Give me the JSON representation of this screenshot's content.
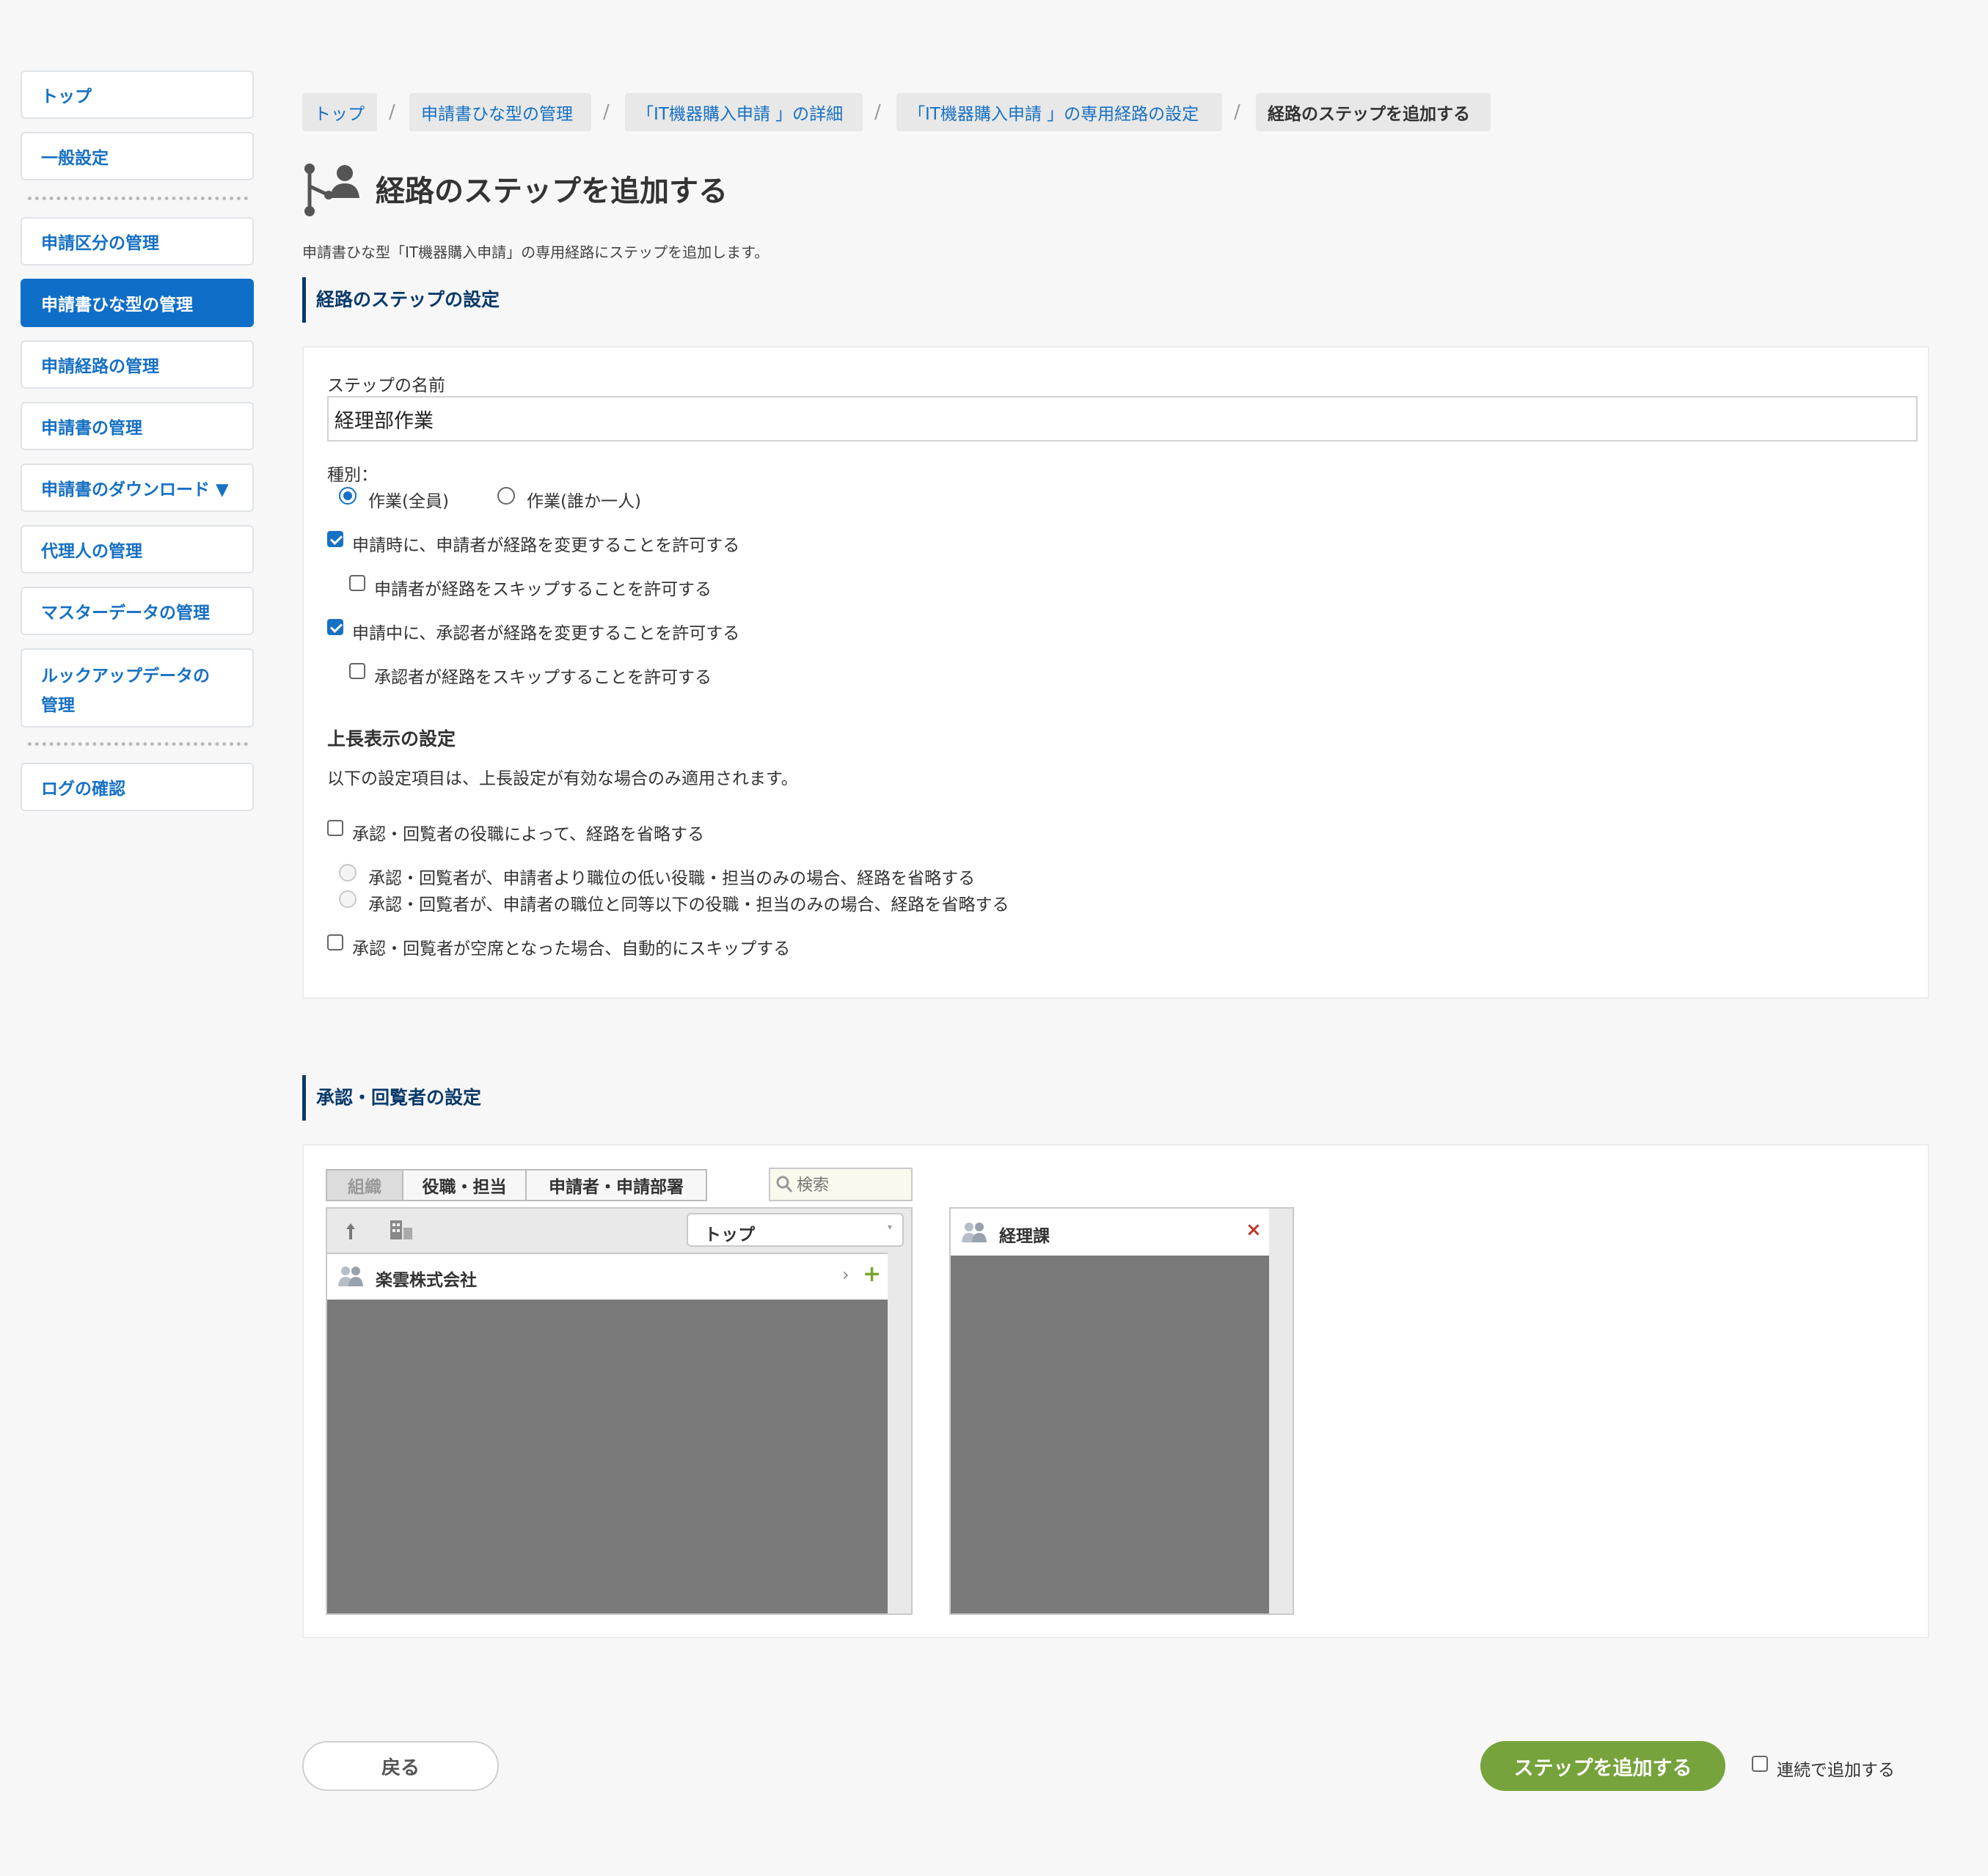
{
  "sidebar": {
    "items": [
      {
        "label": "トップ"
      },
      {
        "label": "一般設定"
      },
      {
        "label": "申請区分の管理"
      },
      {
        "label": "申請書ひな型の管理"
      },
      {
        "label": "申請経路の管理"
      },
      {
        "label": "申請書の管理"
      },
      {
        "label": "申請書のダウンロード ▼"
      },
      {
        "label": "代理人の管理"
      },
      {
        "label": "マスターデータの管理"
      },
      {
        "label": "ルックアップデータの管理"
      },
      {
        "label": "ログの確認"
      }
    ]
  },
  "breadcrumb": [
    {
      "label": "トップ"
    },
    {
      "label": "申請書ひな型の管理"
    },
    {
      "label": "「IT機器購入申請 」の詳細"
    },
    {
      "label": "「IT機器購入申請 」の専用経路の設定"
    },
    {
      "label": "経路のステップを追加する"
    }
  ],
  "breadcrumb_separator": "/",
  "page": {
    "title": "経路のステップを追加する",
    "description": "申請書ひな型「IT機器購入申請」の専用経路にステップを追加します。"
  },
  "step_settings": {
    "heading": "経路のステップの設定",
    "name_label": "ステップの名前",
    "name_value": "経理部作業",
    "type_label": "種別：",
    "type_options": [
      {
        "label": "作業(全員)"
      },
      {
        "label": "作業(誰か一人)"
      }
    ],
    "permissions": [
      {
        "label": "申請時に、申請者が経路を変更することを許可する"
      },
      {
        "label": "申請者が経路をスキップすることを許可する"
      },
      {
        "label": "申請中に、承認者が経路を変更することを許可する"
      },
      {
        "label": "承認者が経路をスキップすることを許可する"
      }
    ],
    "superior_heading": "上長表示の設定",
    "superior_note": "以下の設定項目は、上長設定が有効な場合のみ適用されます。",
    "omit_by_position_label": "承認・回覧者の役職によって、経路を省略する",
    "omit_options": [
      {
        "label": "承認・回覧者が、申請者より職位の低い役職・担当のみの場合、経路を省略する"
      },
      {
        "label": "承認・回覧者が、申請者の職位と同等以下の役職・担当のみの場合、経路を省略する"
      }
    ],
    "skip_vacant_label": "承認・回覧者が空席となった場合、自動的にスキップする"
  },
  "approver_settings": {
    "heading": "承認・回覧者の設定",
    "tabs": [
      {
        "label": "組織"
      },
      {
        "label": "役職・担当"
      },
      {
        "label": "申請者・申請部署"
      }
    ],
    "search_placeholder": "検索",
    "org_select_value": "トップ",
    "org_list": [
      {
        "label": "楽雲株式会社"
      }
    ],
    "selected_list": [
      {
        "label": "経理課"
      }
    ]
  },
  "footer": {
    "back_label": "戻る",
    "submit_label": "ステップを追加する",
    "continuous_label": "連続で追加する"
  },
  "colors": {
    "accent": "#0f6ec8",
    "submit": "#76a33b",
    "heading": "#0a3a6a"
  }
}
